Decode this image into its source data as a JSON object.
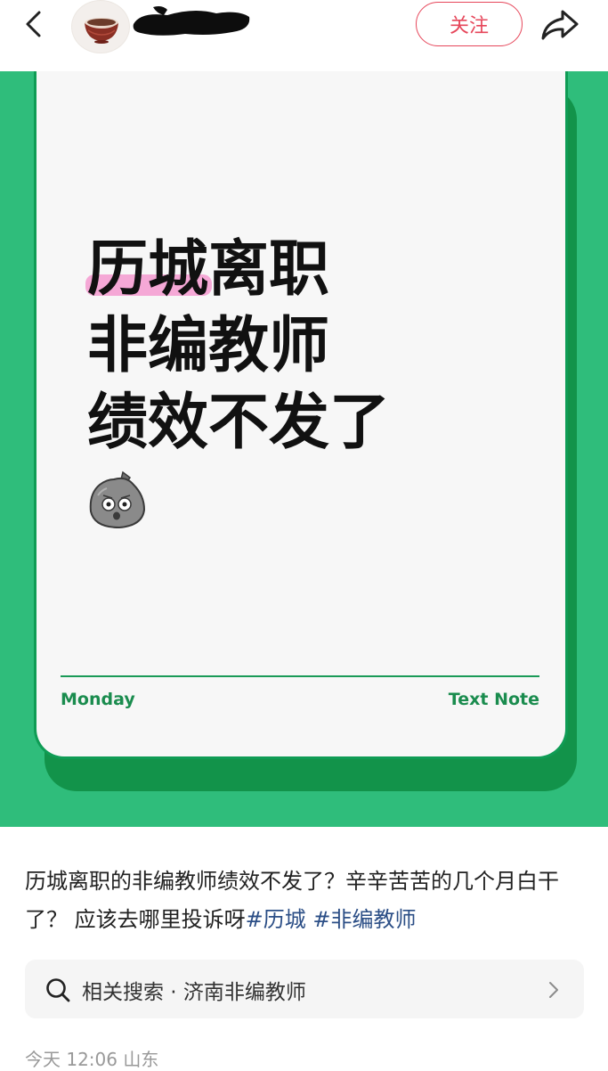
{
  "header": {
    "follow_label": "关注"
  },
  "card": {
    "headline": {
      "line1_highlight": "历城",
      "line1_rest": "离职",
      "line2": "非编教师",
      "line3": "绩效不发了"
    },
    "emoji": "grey-sack-face",
    "footer_left": "Monday",
    "footer_right": "Text Note"
  },
  "post": {
    "text": "历城离职的非编教师绩效不发了？辛辛苦苦的几个月白干了？ 应该去哪里投诉呀",
    "hashtags": [
      "#历城",
      "#非编教师"
    ]
  },
  "related_search": {
    "label": "相关搜索 · 济南非编教师"
  },
  "meta": {
    "time": "今天 12:06",
    "location": "山东"
  },
  "colors": {
    "hero_green": "#2fbd7b",
    "card_border": "#0f9c55",
    "footer_green": "#1a8c4e",
    "follow_red": "#e6475b",
    "hashtag_blue": "#2b4e86",
    "highlight_pink": "#f5a8d6"
  }
}
